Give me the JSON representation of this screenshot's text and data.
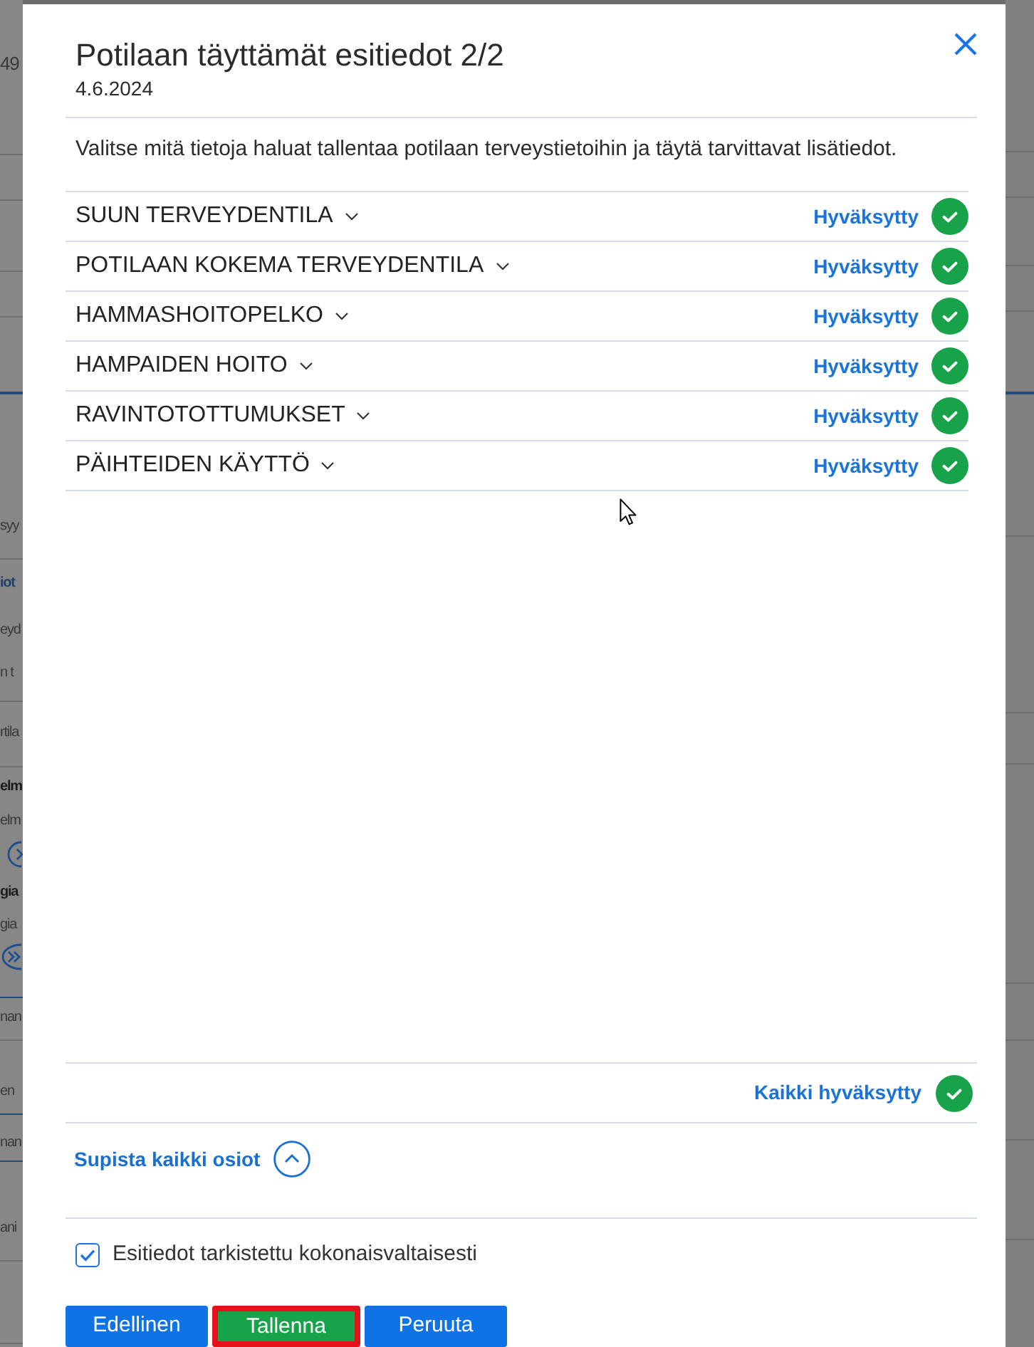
{
  "background": {
    "fragments": [
      {
        "text": "49",
        "kind": "large"
      },
      {
        "text": "syy",
        "kind": "plain"
      },
      {
        "text": "iot",
        "kind": "link"
      },
      {
        "text": "eyd",
        "kind": "plain"
      },
      {
        "text": "n t",
        "kind": "plain"
      },
      {
        "text": "rtila",
        "kind": "plain"
      },
      {
        "text": "elm",
        "kind": "bold"
      },
      {
        "text": "elm",
        "kind": "plain"
      },
      {
        "text": "gia",
        "kind": "bold"
      },
      {
        "text": "gia",
        "kind": "plain"
      },
      {
        "text": "nan",
        "kind": "plain"
      },
      {
        "text": "en",
        "kind": "plain"
      },
      {
        "text": "nan",
        "kind": "plain"
      },
      {
        "text": "ani",
        "kind": "plain"
      }
    ]
  },
  "dialog": {
    "title": "Potilaan täyttämät esitiedot 2/2",
    "date": "4.6.2024",
    "instructions": "Valitse mitä tietoja haluat tallentaa potilaan terveystietoihin ja täytä tarvittavat lisätiedot.",
    "sections": [
      {
        "title": "SUUN TERVEYDENTILA",
        "expanded": false,
        "status": "Hyväksytty",
        "approved": true
      },
      {
        "title": "POTILAAN KOKEMA TERVEYDENTILA",
        "expanded": false,
        "status": "Hyväksytty",
        "approved": true
      },
      {
        "title": "HAMMASHOITOPELKO",
        "expanded": false,
        "status": "Hyväksytty",
        "approved": true
      },
      {
        "title": "HAMPAIDEN HOITO",
        "expanded": false,
        "status": "Hyväksytty",
        "approved": true
      },
      {
        "title": "RAVINTOTOTTUMUKSET",
        "expanded": false,
        "status": "Hyväksytty",
        "approved": true
      },
      {
        "title": "PÄIHTEIDEN KÄYTTÖ",
        "expanded": false,
        "status": "Hyväksytty",
        "approved": true
      }
    ],
    "summary": {
      "label": "Kaikki hyväksytty",
      "approved": true
    },
    "collapse_all": {
      "label": "Supista kaikki osiot"
    },
    "confirmation": {
      "label": "Esitiedot tarkistettu kokonaisvaltaisesti",
      "checked": true
    },
    "buttons": [
      {
        "label": "Edellinen",
        "color": "#0f72e5",
        "highlighted": false
      },
      {
        "label": "Tallenna",
        "color": "#17a34a",
        "highlighted": true
      },
      {
        "label": "Peruuta",
        "color": "#0f72e5",
        "highlighted": false
      }
    ]
  }
}
